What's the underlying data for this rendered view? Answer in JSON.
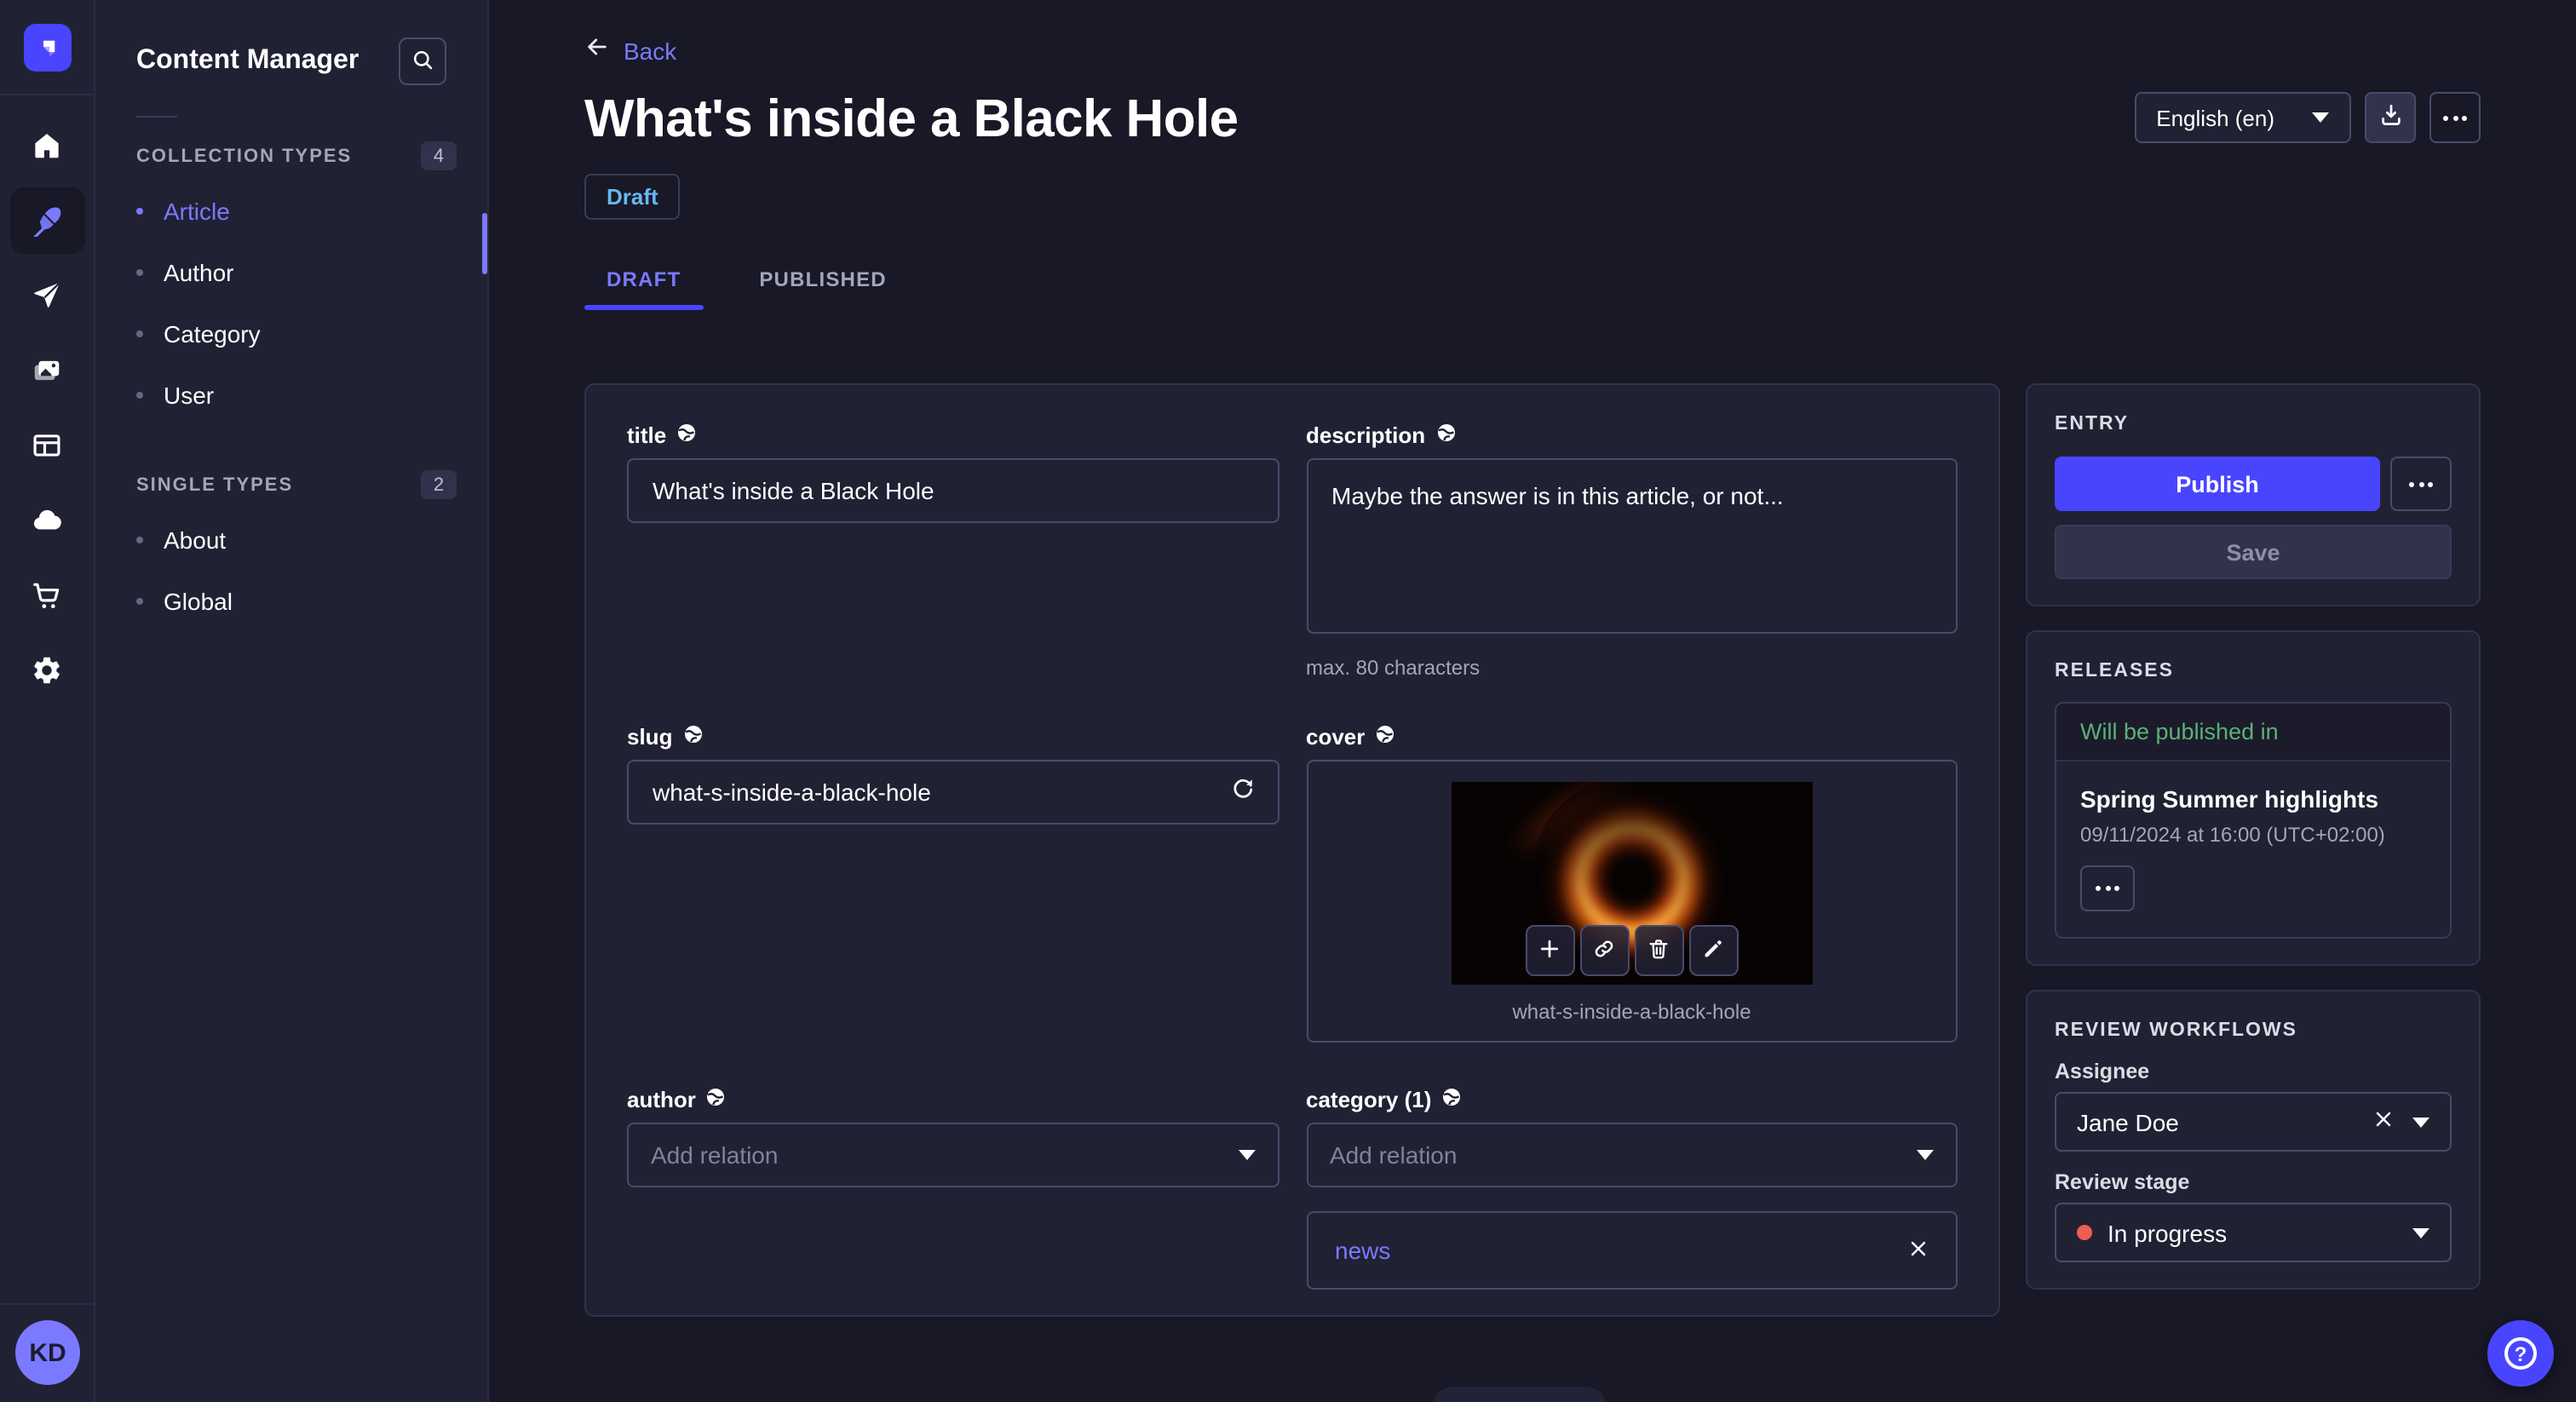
{
  "colors": {
    "accent": "#4945ff",
    "accent_light": "#7b79ff",
    "page_bg": "#181826",
    "panel_bg": "#212134",
    "border": "#32324d",
    "success": "#5cb176",
    "danger": "#ee5e52",
    "draft_blue": "#66b7f1"
  },
  "nav_rail": {
    "avatar_initials": "KD",
    "icons": [
      "strapi-logo",
      "home",
      "content-manager",
      "releases",
      "media-library",
      "content-type-builder",
      "cloud",
      "marketplace",
      "settings"
    ]
  },
  "sidebar": {
    "title": "Content Manager",
    "sections": [
      {
        "label": "COLLECTION TYPES",
        "count": "4",
        "items": [
          {
            "label": "Article",
            "active": true
          },
          {
            "label": "Author",
            "active": false
          },
          {
            "label": "Category",
            "active": false
          },
          {
            "label": "User",
            "active": false
          }
        ]
      },
      {
        "label": "SINGLE TYPES",
        "count": "2",
        "items": [
          {
            "label": "About",
            "active": false
          },
          {
            "label": "Global",
            "active": false
          }
        ]
      }
    ]
  },
  "header": {
    "back": "Back",
    "title": "What's inside a Black Hole",
    "status": "Draft",
    "locale": "English (en)"
  },
  "tabs": {
    "draft": "DRAFT",
    "published": "PUBLISHED"
  },
  "form": {
    "title": {
      "label": "title",
      "value": "What's inside a Black Hole"
    },
    "description": {
      "label": "description",
      "value": "Maybe the answer is in this article, or not...",
      "hint": "max. 80 characters"
    },
    "slug": {
      "label": "slug",
      "value": "what-s-inside-a-black-hole"
    },
    "cover": {
      "label": "cover",
      "caption": "what-s-inside-a-black-hole"
    },
    "author": {
      "label": "author",
      "placeholder": "Add relation"
    },
    "category": {
      "label": "category (1)",
      "placeholder": "Add relation",
      "relations": [
        "news"
      ]
    }
  },
  "entry_panel": {
    "title": "ENTRY",
    "publish": "Publish",
    "save": "Save"
  },
  "releases_panel": {
    "title": "RELEASES",
    "status": "Will be published in",
    "release_name": "Spring Summer highlights",
    "release_date": "09/11/2024 at 16:00 (UTC+02:00)"
  },
  "review_panel": {
    "title": "REVIEW WORKFLOWS",
    "assignee_label": "Assignee",
    "assignee": "Jane Doe",
    "stage_label": "Review stage",
    "stage": "In progress"
  },
  "fab": {
    "help_glyph": "?"
  }
}
